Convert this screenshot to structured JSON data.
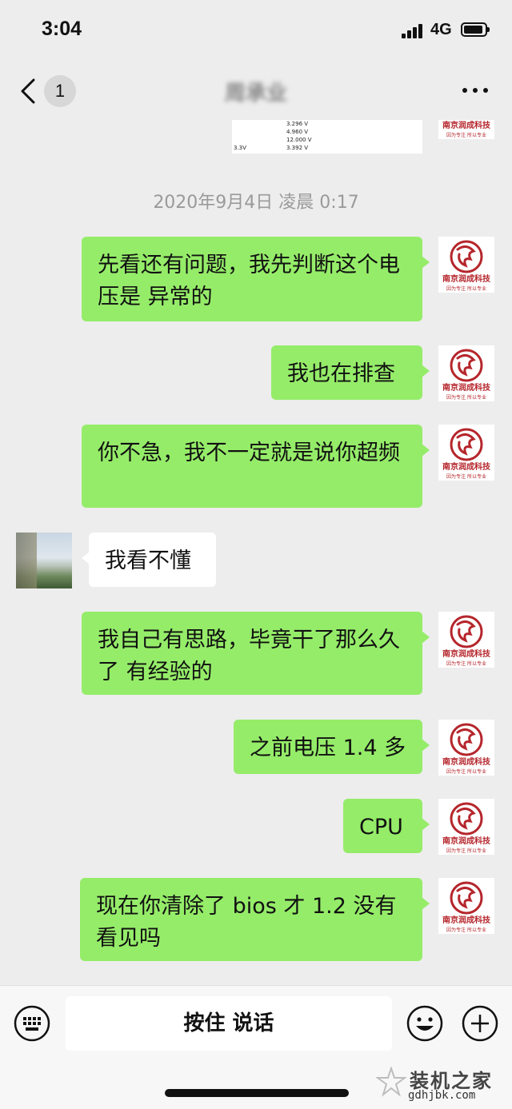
{
  "status_bar": {
    "time": "3:04",
    "network": "4G"
  },
  "nav": {
    "back_label": "‹",
    "unread_count": "1",
    "title": "周承业",
    "more_label": "···"
  },
  "snippet": {
    "rows": [
      "3.296 V",
      "4.960 V",
      "12.000 V",
      "3.392 V"
    ],
    "side_label": "3.3V"
  },
  "timestamp": "2020年9月4日 凌晨 0:17",
  "logo": {
    "name": "南京润成科技",
    "slogan": "因为专注 所以专业",
    "color": "#b5262c"
  },
  "messages": [
    {
      "direction": "out",
      "text": "先看还有问题，我先判断这个电压是 异常的"
    },
    {
      "direction": "out",
      "text": "我也在排查"
    },
    {
      "direction": "out",
      "text": "你不急，我不一定就是说你超频"
    },
    {
      "direction": "in",
      "text": "我看不懂"
    },
    {
      "direction": "out",
      "text": "我自己有思路，毕竟干了那么久了 有经验的"
    },
    {
      "direction": "out",
      "text": "之前电压 1.4 多"
    },
    {
      "direction": "out",
      "text": "CPU"
    },
    {
      "direction": "out",
      "text": "现在你清除了 bios  才 1.2 没有看见吗"
    }
  ],
  "input_bar": {
    "voice_label": "按住 说话"
  },
  "watermark": {
    "title": "装机之家",
    "url": "gdhjbk.com"
  },
  "colors": {
    "bubble_out": "#95ec69",
    "bubble_in": "#ffffff",
    "background": "#ededed"
  }
}
